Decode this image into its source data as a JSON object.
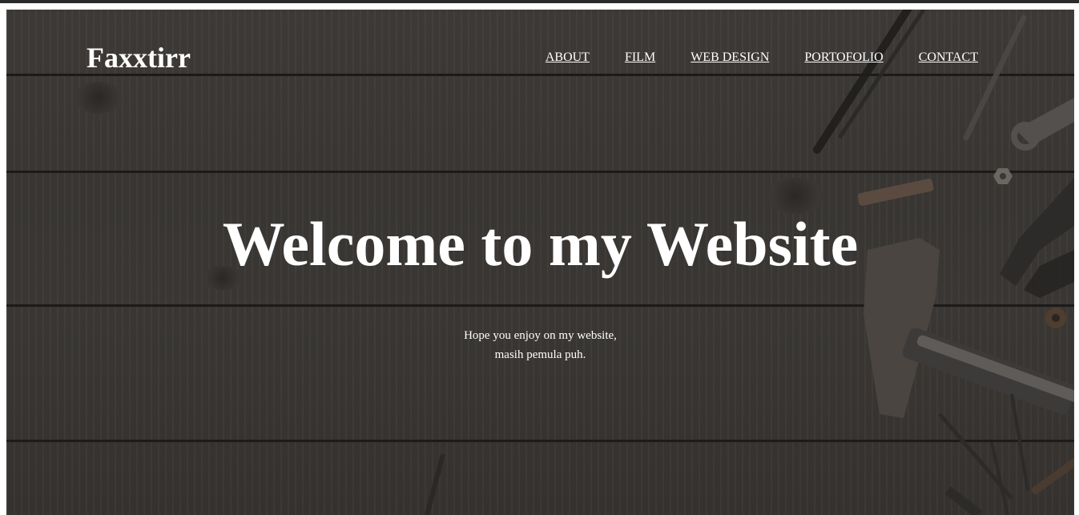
{
  "brand": {
    "name": "Faxxtirr"
  },
  "nav": {
    "items": [
      {
        "label": "ABOUT"
      },
      {
        "label": "FILM"
      },
      {
        "label": "WEB DESIGN"
      },
      {
        "label": "PORTOFOLIO"
      },
      {
        "label": "CONTACT"
      }
    ]
  },
  "hero": {
    "title": "Welcome to my Website",
    "subtitle_line1": "Hope you enjoy on my website,",
    "subtitle_line2": "masih pemula puh."
  },
  "colors": {
    "background_overlay": "#3a3734",
    "text": "#ffffff",
    "top_bar": "#2b2b2b"
  }
}
